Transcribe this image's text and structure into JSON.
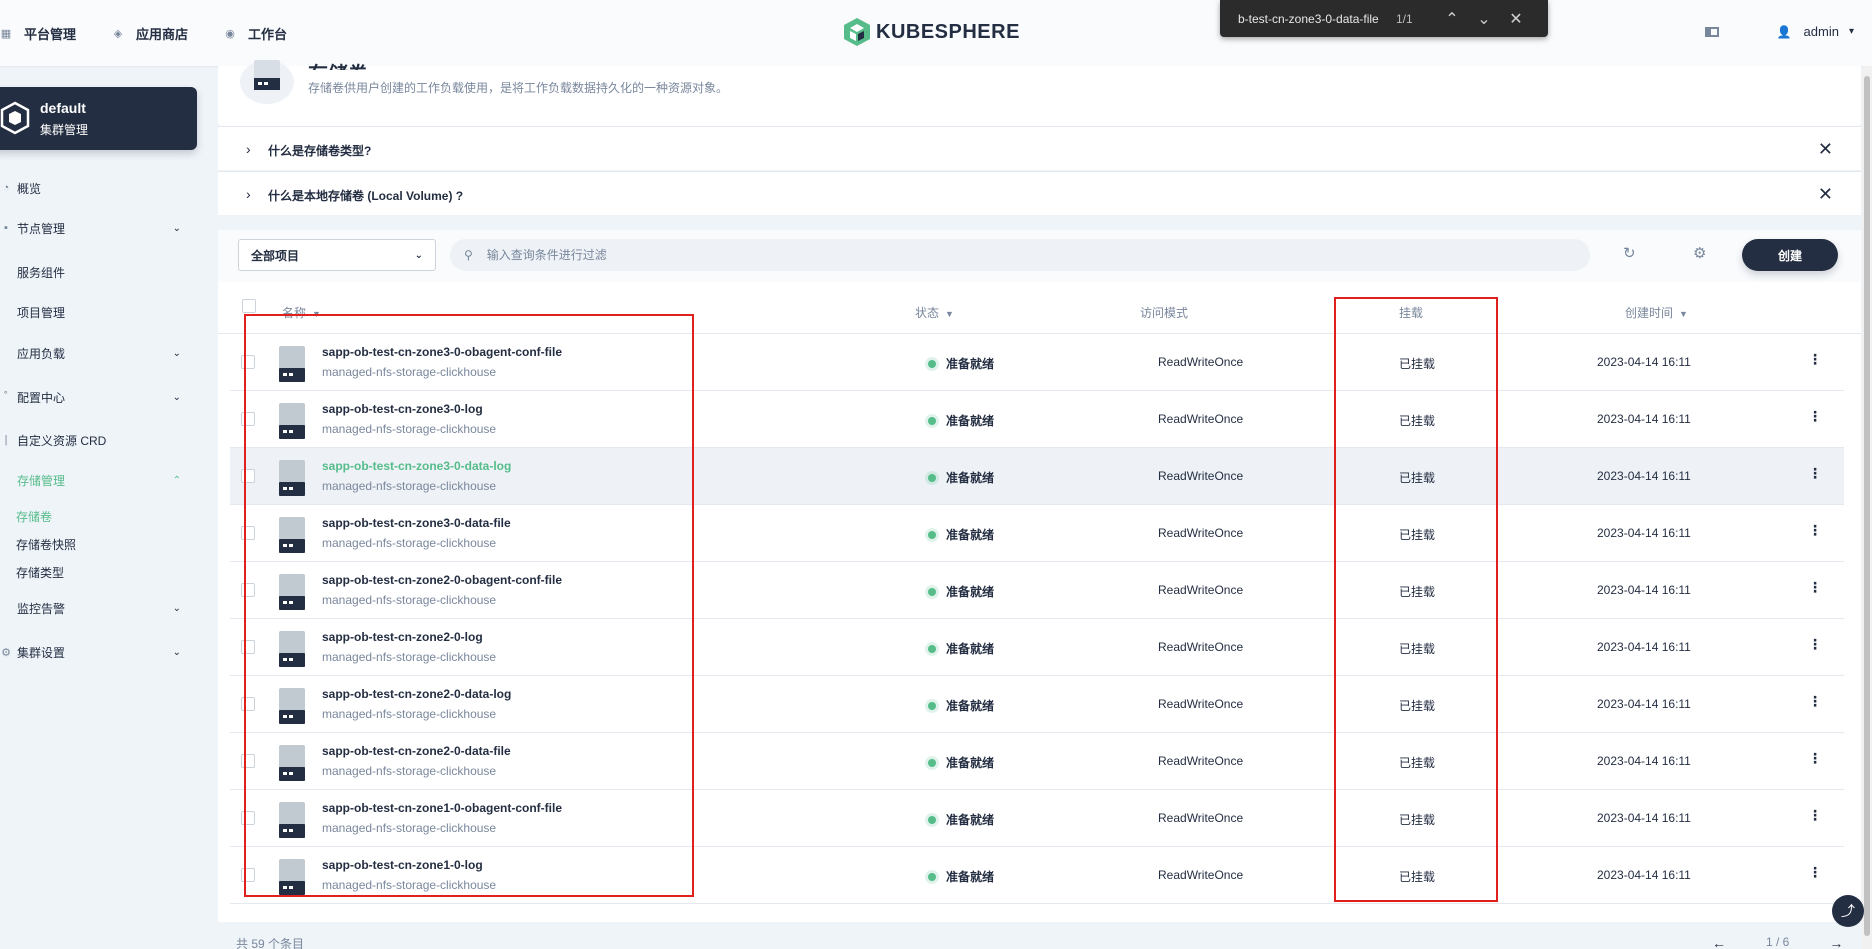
{
  "top_nav": [
    {
      "icon": "platform-icon",
      "label": "平台管理"
    },
    {
      "icon": "app-store-icon",
      "label": "应用商店"
    },
    {
      "icon": "workbench-icon",
      "label": "工作台"
    }
  ],
  "brand": {
    "logo_text": "KUBESPHERE",
    "color": "#55bc8a"
  },
  "user": {
    "name": "admin"
  },
  "find_bar": {
    "query": "b-test-cn-zone3-0-data-file",
    "count": "1/1"
  },
  "cluster": {
    "name": "default",
    "subtitle": "集群管理"
  },
  "sidebar": {
    "items": [
      {
        "label": "概览",
        "icon": "dashboard-icon",
        "has_chevron": false
      },
      {
        "label": "节点管理",
        "icon": "node-icon",
        "has_chevron": true
      },
      {
        "label": "服务组件",
        "icon": "component-icon",
        "has_chevron": false
      },
      {
        "label": "项目管理",
        "icon": "project-icon",
        "has_chevron": false
      },
      {
        "label": "应用负载",
        "icon": "workload-icon",
        "has_chevron": true
      },
      {
        "label": "配置中心",
        "icon": "config-icon",
        "has_chevron": true
      },
      {
        "label": "自定义资源 CRD",
        "icon": "crd-icon",
        "has_chevron": false
      },
      {
        "label": "存储管理",
        "icon": "storage-icon",
        "has_chevron": true,
        "active": true
      },
      {
        "label": "监控告警",
        "icon": "monitor-icon",
        "has_chevron": true
      },
      {
        "label": "集群设置",
        "icon": "settings-icon",
        "has_chevron": true
      }
    ],
    "storage_sub": [
      "存储卷",
      "存储卷快照",
      "存储类型"
    ]
  },
  "page": {
    "title": "存储卷",
    "description": "存储卷供用户创建的工作负载使用，是将工作负载数据持久化的一种资源对象。"
  },
  "tips": [
    "什么是存储卷类型?",
    "什么是本地存储卷 (Local Volume) ?"
  ],
  "toolbar": {
    "project_select": "全部项目",
    "search_placeholder": "输入查询条件进行过滤",
    "create_label": "创建"
  },
  "table": {
    "columns": [
      "名称",
      "状态",
      "访问模式",
      "挂载",
      "创建时间"
    ],
    "rows": [
      {
        "name": "sapp-ob-test-cn-zone3-0-obagent-conf-file",
        "sc": "managed-nfs-storage-clickhouse",
        "status": "准备就绪",
        "mode": "ReadWriteOnce",
        "mount": "已挂载",
        "time": "2023-04-14 16:11"
      },
      {
        "name": "sapp-ob-test-cn-zone3-0-log",
        "sc": "managed-nfs-storage-clickhouse",
        "status": "准备就绪",
        "mode": "ReadWriteOnce",
        "mount": "已挂载",
        "time": "2023-04-14 16:11"
      },
      {
        "name": "sapp-ob-test-cn-zone3-0-data-log",
        "sc": "managed-nfs-storage-clickhouse",
        "status": "准备就绪",
        "mode": "ReadWriteOnce",
        "mount": "已挂载",
        "time": "2023-04-14 16:11"
      },
      {
        "name": "sapp-ob-test-cn-zone3-0-data-file",
        "sc": "managed-nfs-storage-clickhouse",
        "status": "准备就绪",
        "mode": "ReadWriteOnce",
        "mount": "已挂载",
        "time": "2023-04-14 16:11"
      },
      {
        "name": "sapp-ob-test-cn-zone2-0-obagent-conf-file",
        "sc": "managed-nfs-storage-clickhouse",
        "status": "准备就绪",
        "mode": "ReadWriteOnce",
        "mount": "已挂载",
        "time": "2023-04-14 16:11"
      },
      {
        "name": "sapp-ob-test-cn-zone2-0-log",
        "sc": "managed-nfs-storage-clickhouse",
        "status": "准备就绪",
        "mode": "ReadWriteOnce",
        "mount": "已挂载",
        "time": "2023-04-14 16:11"
      },
      {
        "name": "sapp-ob-test-cn-zone2-0-data-log",
        "sc": "managed-nfs-storage-clickhouse",
        "status": "准备就绪",
        "mode": "ReadWriteOnce",
        "mount": "已挂载",
        "time": "2023-04-14 16:11"
      },
      {
        "name": "sapp-ob-test-cn-zone2-0-data-file",
        "sc": "managed-nfs-storage-clickhouse",
        "status": "准备就绪",
        "mode": "ReadWriteOnce",
        "mount": "已挂载",
        "time": "2023-04-14 16:11"
      },
      {
        "name": "sapp-ob-test-cn-zone1-0-obagent-conf-file",
        "sc": "managed-nfs-storage-clickhouse",
        "status": "准备就绪",
        "mode": "ReadWriteOnce",
        "mount": "已挂载",
        "time": "2023-04-14 16:11"
      },
      {
        "name": "sapp-ob-test-cn-zone1-0-log",
        "sc": "managed-nfs-storage-clickhouse",
        "status": "准备就绪",
        "mode": "ReadWriteOnce",
        "mount": "已挂载",
        "time": "2023-04-14 16:11"
      }
    ],
    "hover_row": 2
  },
  "footer": {
    "total": "共 59 个条目",
    "page": "1 / 6"
  },
  "colors": {
    "accent": "#55bc8a",
    "dark": "#242e42",
    "annotation": "#e0201d"
  }
}
